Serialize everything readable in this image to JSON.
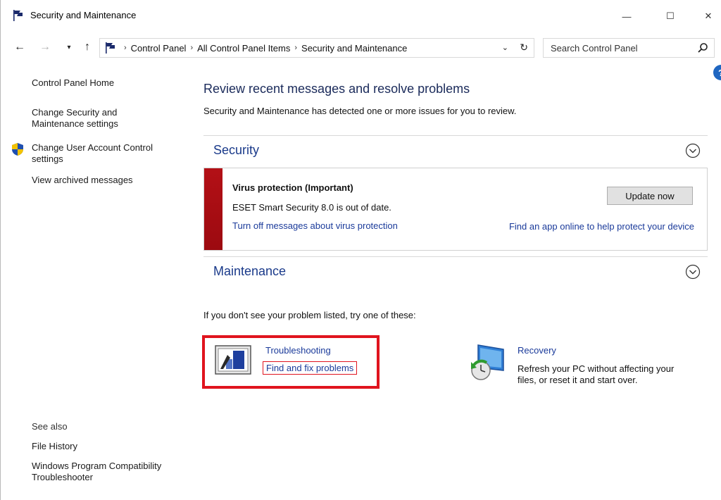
{
  "window": {
    "title": "Security and Maintenance",
    "minimize_glyph": "—",
    "maximize_glyph": "☐",
    "close_glyph": "✕"
  },
  "nav": {
    "back_glyph": "←",
    "forward_glyph": "→",
    "recent_glyph": "▾",
    "up_glyph": "↑",
    "breadcrumb": [
      "Control Panel",
      "All Control Panel Items",
      "Security and Maintenance"
    ],
    "breadcrumb_sep": "›",
    "dropdown_glyph": "⌄",
    "refresh_glyph": "↻"
  },
  "search": {
    "placeholder": "Search Control Panel"
  },
  "help": {
    "glyph": "?"
  },
  "left_pane": {
    "home": "Control Panel Home",
    "change_security": "Change Security and Maintenance settings",
    "change_uac": "Change User Account Control settings",
    "archived": "View archived messages",
    "see_also": "See also",
    "file_history": "File History",
    "compat": "Windows Program Compatibility Troubleshooter"
  },
  "main": {
    "title": "Review recent messages and resolve problems",
    "description": "Security and Maintenance has detected one or more issues for you to review.",
    "security_label": "Security",
    "maintenance_label": "Maintenance",
    "alert": {
      "title": "Virus protection  (Important)",
      "description": "ESET Smart Security 8.0 is out of date.",
      "turn_off_link": "Turn off messages about virus protection",
      "update_button": "Update now",
      "find_app_link": "Find an app online to help protect your device"
    },
    "try_text": "If you don't see your problem listed, try one of these:",
    "troubleshooting": {
      "title": "Troubleshooting",
      "link": "Find and fix problems"
    },
    "recovery": {
      "title": "Recovery",
      "description": "Refresh your PC without affecting your files, or reset it and start over."
    }
  },
  "colors": {
    "link": "#1a3a9a",
    "alert_bar": "#b31016",
    "highlight": "#e0141e",
    "section_heading": "#1a3a8a"
  }
}
